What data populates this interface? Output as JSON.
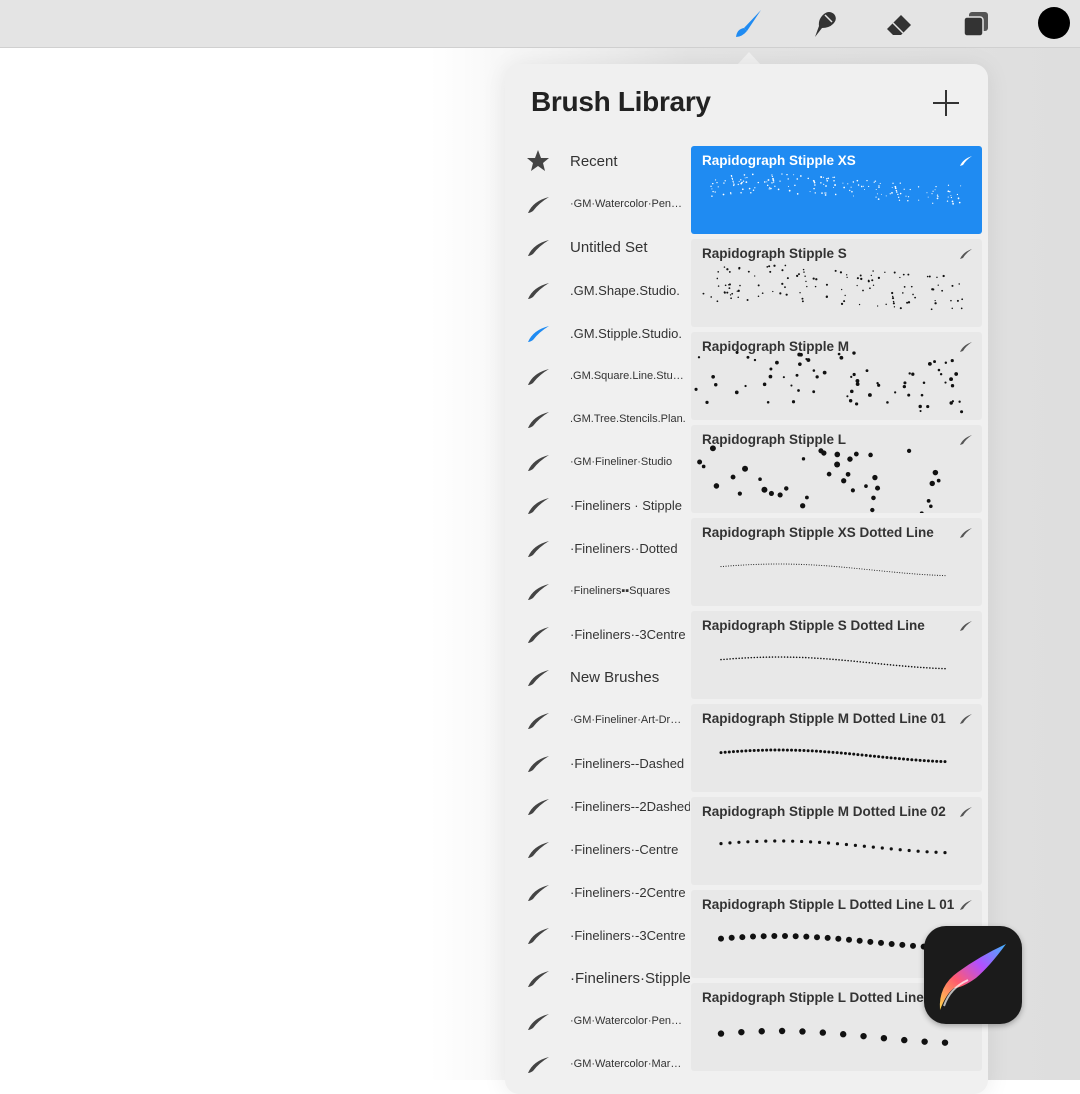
{
  "toolbar": {
    "tools": [
      {
        "name": "brush-icon",
        "active": true
      },
      {
        "name": "smudge-icon",
        "active": false
      },
      {
        "name": "eraser-icon",
        "active": false
      },
      {
        "name": "layers-icon",
        "active": false
      }
    ],
    "current_color": "#000000",
    "accent_color": "#1f8bf2"
  },
  "library": {
    "title": "Brush Library",
    "add_icon": "plus-icon",
    "sets": [
      {
        "label": "Recent",
        "size": "lg",
        "icon": "star-icon"
      },
      {
        "label": "·GM·Watercolor·Pen…",
        "size": "sm",
        "icon": "brush-set-icon"
      },
      {
        "label": "Untitled Set",
        "size": "lg",
        "icon": "brush-set-icon"
      },
      {
        "label": ".GM.Shape.Studio.",
        "size": "md",
        "icon": "brush-set-icon"
      },
      {
        "label": ".GM.Stipple.Studio.",
        "size": "md",
        "icon": "brush-set-icon",
        "selected": true
      },
      {
        "label": ".GM.Square.Line.Stu…",
        "size": "sm",
        "icon": "brush-set-icon"
      },
      {
        "label": ".GM.Tree.Stencils.Plan.",
        "size": "sm",
        "icon": "brush-set-icon"
      },
      {
        "label": "·GM·Fineliner·Studio",
        "size": "sm",
        "icon": "brush-set-icon"
      },
      {
        "label": "·Fineliners · Stipple",
        "size": "md",
        "icon": "brush-set-icon"
      },
      {
        "label": "·Fineliners··Dotted",
        "size": "md",
        "icon": "brush-set-icon"
      },
      {
        "label": "·Fineliners▪▪Squares",
        "size": "sm",
        "icon": "brush-set-icon"
      },
      {
        "label": "·Fineliners·-3Centre",
        "size": "md",
        "icon": "brush-set-icon"
      },
      {
        "label": "New Brushes",
        "size": "lg",
        "icon": "brush-set-icon"
      },
      {
        "label": "·GM·Fineliner·Art-Dr…",
        "size": "sm",
        "icon": "brush-set-icon"
      },
      {
        "label": "·Fineliners--Dashed",
        "size": "md",
        "icon": "brush-set-icon"
      },
      {
        "label": "·Fineliners--2Dashed",
        "size": "md",
        "icon": "brush-set-icon"
      },
      {
        "label": "·Fineliners·-Centre",
        "size": "md",
        "icon": "brush-set-icon"
      },
      {
        "label": "·Fineliners·-2Centre",
        "size": "md",
        "icon": "brush-set-icon"
      },
      {
        "label": "·Fineliners·-3Centre",
        "size": "md",
        "icon": "brush-set-icon"
      },
      {
        "label": "·Fineliners·Stipple",
        "size": "lg",
        "icon": "brush-set-icon"
      },
      {
        "label": "·GM·Watercolor·Pen…",
        "size": "sm",
        "icon": "brush-set-icon"
      },
      {
        "label": "·GM·Watercolor·Mar…",
        "size": "sm",
        "icon": "brush-set-icon"
      }
    ],
    "brushes": [
      {
        "name": "Rapidograph Stipple XS",
        "selected": true,
        "style": "scatter-xs"
      },
      {
        "name": "Rapidograph Stipple S",
        "style": "scatter-s"
      },
      {
        "name": "Rapidograph Stipple M",
        "style": "scatter-m"
      },
      {
        "name": "Rapidograph Stipple L",
        "style": "scatter-l"
      },
      {
        "name": "Rapidograph Stipple XS Dotted Line",
        "style": "line-xs"
      },
      {
        "name": "Rapidograph Stipple S Dotted Line",
        "style": "line-s"
      },
      {
        "name": "Rapidograph Stipple M Dotted Line 01",
        "style": "line-m1"
      },
      {
        "name": "Rapidograph Stipple M Dotted Line 02",
        "style": "line-m2"
      },
      {
        "name": "Rapidograph Stipple L Dotted Line L 01",
        "style": "line-l1"
      },
      {
        "name": "Rapidograph Stipple L Dotted Line",
        "style": "line-l2"
      }
    ]
  },
  "app_icon": "procreate-logo"
}
